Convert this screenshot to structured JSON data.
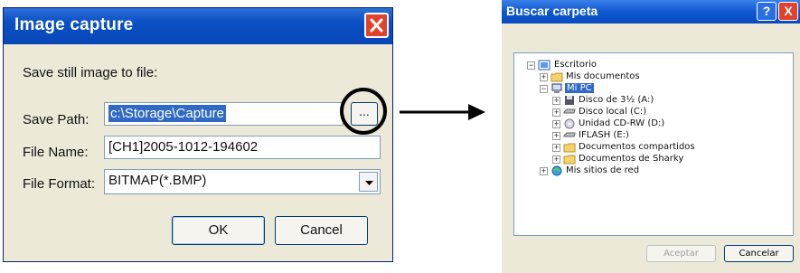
{
  "capture_dialog": {
    "title": "Image capture",
    "heading": "Save still image to file:",
    "save_path_label": "Save Path:",
    "save_path_value": "c:\\Storage\\Capture",
    "browse_label": "...",
    "file_name_label": "File Name:",
    "file_name_value": "[CH1]2005-1012-194602",
    "file_format_label": "File Format:",
    "file_format_value": "BITMAP(*.BMP)",
    "ok_label": "OK",
    "cancel_label": "Cancel",
    "close_icon": "close-icon"
  },
  "folder_dialog": {
    "title": "Buscar carpeta",
    "help_label": "?",
    "close_label": "X",
    "tree": [
      {
        "label": "Escritorio",
        "icon": "desktop-icon",
        "toggle": "−"
      },
      {
        "label": "Mis documentos",
        "icon": "folder-icon",
        "toggle": "+"
      },
      {
        "label": "Mi PC",
        "icon": "computer-icon",
        "toggle": "−",
        "selected": true
      },
      {
        "label": "Disco de 3½ (A:)",
        "icon": "floppy-icon",
        "toggle": "+"
      },
      {
        "label": "Disco local (C:)",
        "icon": "drive-icon",
        "toggle": "+"
      },
      {
        "label": "Unidad CD-RW (D:)",
        "icon": "cd-icon",
        "toggle": "+"
      },
      {
        "label": "IFLASH (E:)",
        "icon": "drive-icon",
        "toggle": "+"
      },
      {
        "label": "Documentos compartidos",
        "icon": "folder-icon",
        "toggle": "+"
      },
      {
        "label": "Documentos de Sharky",
        "icon": "folder-icon",
        "toggle": "+"
      },
      {
        "label": "Mis sitios de red",
        "icon": "network-icon",
        "toggle": "+"
      }
    ],
    "accept_label": "Aceptar",
    "cancel_label": "Cancelar"
  },
  "colors": {
    "title_bar": "#0a4fc4",
    "selection": "#316ac5",
    "close": "#e0432b",
    "dialog_bg": "#ece9d8"
  }
}
